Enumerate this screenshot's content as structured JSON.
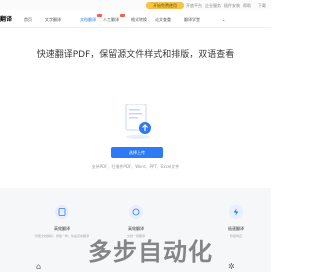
{
  "topbar": {
    "badge": "开始免费使用",
    "links": [
      "开放平台",
      "企业服务",
      "插件安装",
      "帮助",
      "下载"
    ]
  },
  "nav": {
    "logo": "翻译",
    "items": [
      {
        "label": "首页",
        "active": false
      },
      {
        "label": "文字翻译",
        "active": false
      },
      {
        "label": "文档翻译",
        "active": true,
        "tag": true
      },
      {
        "label": "人工翻译",
        "active": false,
        "tag": true
      },
      {
        "label": "格式转换",
        "active": false
      },
      {
        "label": "论文查重",
        "active": false
      },
      {
        "label": "翻译学堂",
        "active": false
      }
    ]
  },
  "headline": "快速翻译PDF，保留源文件样式和排版，双语查看",
  "upload": {
    "button": "选择上传",
    "formats": "支持PDF、扫描件PDF、Word、PPT、Excel文件"
  },
  "features": [
    {
      "title": "高效翻译",
      "desc": "智能文档解析，排版一样，快速完成翻译",
      "color": "#e8eefc",
      "icon": "document-icon"
    },
    {
      "title": "高效翻译",
      "desc": "文档一键翻译",
      "color": "#e8eefc",
      "icon": "translate-icon"
    },
    {
      "title": "极速翻译",
      "desc": "秒级响应",
      "color": "#e6f0ff",
      "icon": "lightning-icon"
    }
  ],
  "watermark": "多步自动化",
  "colors": {
    "accent": "#2e79f6",
    "tag": "#ff5a4a",
    "badge": "#f5c24a"
  }
}
